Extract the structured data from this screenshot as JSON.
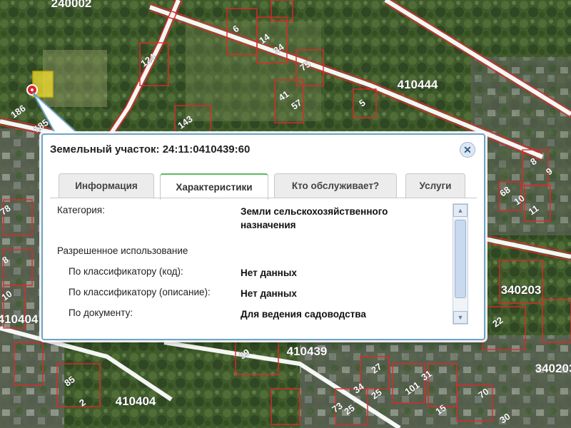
{
  "map": {
    "block_labels": [
      "240002",
      "410444",
      "410404",
      "340203",
      "410404",
      "410439",
      "340203"
    ],
    "parcel_labels": [
      "6",
      "14",
      "34",
      "124",
      "75",
      "41",
      "57",
      "5",
      "186",
      "185",
      "143",
      "8",
      "9",
      "68",
      "10",
      "11",
      "78",
      "8",
      "10",
      "34",
      "25",
      "59",
      "85",
      "73",
      "27",
      "22",
      "101",
      "31",
      "70",
      "25",
      "30",
      "2",
      "15"
    ],
    "colors": {
      "parcel_outline": "#e02828",
      "road": "#ffffff"
    }
  },
  "popup": {
    "title": "Земельный участок: 24:11:0410439:60",
    "close_icon": "close-icon",
    "tabs": [
      "Информация",
      "Характеристики",
      "Кто обслуживает?",
      "Услуги"
    ],
    "active_tab": "Характеристики",
    "fields": {
      "category_label": "Категория:",
      "category_value": "Земли сельскохозяйственного назначения",
      "permitted_use_label": "Разрешенное использование",
      "code_label": "По классификатору (код):",
      "code_value": "Нет данных",
      "desc_label": "По классификатору (описание):",
      "desc_value": "Нет данных",
      "doc_label": "По документу:",
      "doc_value": "Для ведения садоводства"
    }
  }
}
